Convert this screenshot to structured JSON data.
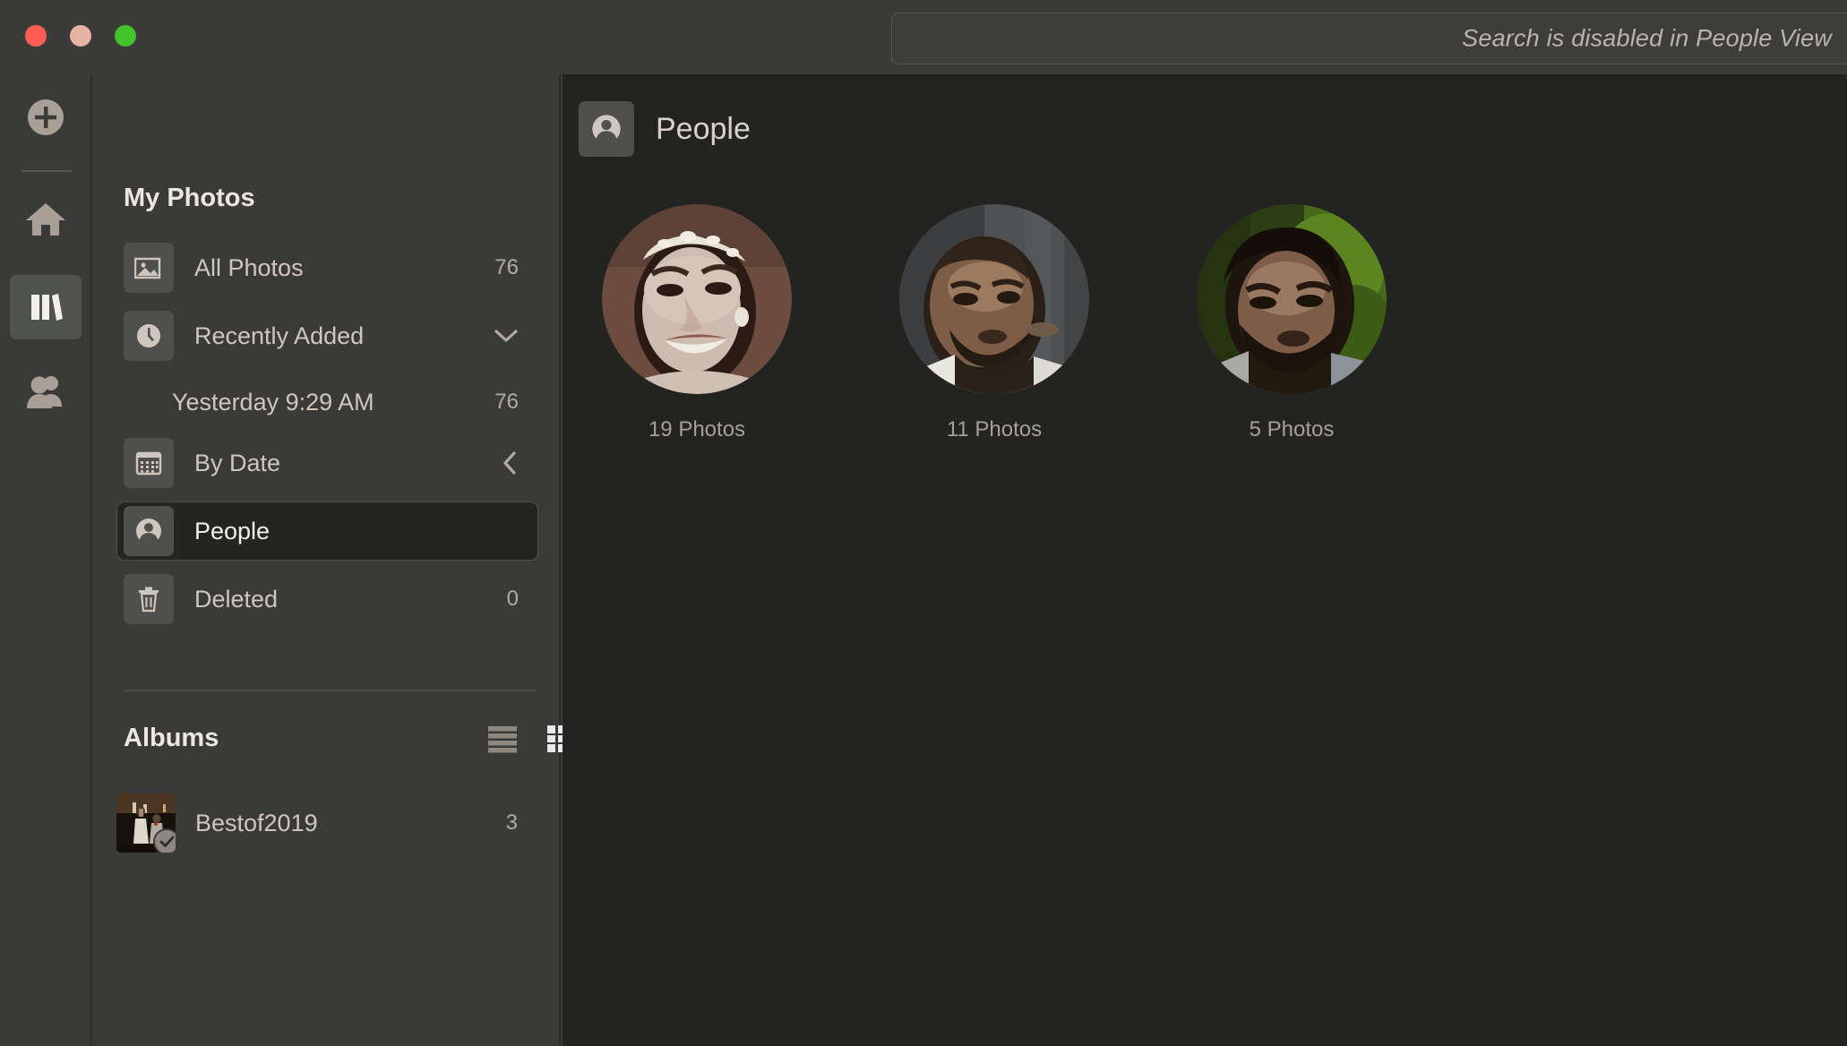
{
  "window": {
    "traffic_lights": [
      "close",
      "minimize",
      "zoom"
    ]
  },
  "search": {
    "placeholder": "Search is disabled in People View",
    "value": ""
  },
  "rail": {
    "items": [
      {
        "name": "add",
        "icon": "plus-circle-icon",
        "selected": false
      },
      {
        "name": "home",
        "icon": "home-icon",
        "selected": false
      },
      {
        "name": "library",
        "icon": "library-icon",
        "selected": true
      },
      {
        "name": "shared",
        "icon": "people-group-icon",
        "selected": false
      }
    ]
  },
  "sidebar": {
    "title": "My Photos",
    "nav": [
      {
        "label": "All Photos",
        "icon": "photo-icon",
        "count": "76",
        "selected": false,
        "accessory": "count"
      },
      {
        "label": "Recently Added",
        "icon": "clock-icon",
        "count": "",
        "selected": false,
        "accessory": "chevron-down"
      },
      {
        "label": "Yesterday 9:29 AM",
        "icon": "",
        "count": "76",
        "selected": false,
        "accessory": "count",
        "sub": true
      },
      {
        "label": "By Date",
        "icon": "calendar-icon",
        "count": "",
        "selected": false,
        "accessory": "chevron-left"
      },
      {
        "label": "People",
        "icon": "person-icon",
        "count": "",
        "selected": true,
        "accessory": "none"
      },
      {
        "label": "Deleted",
        "icon": "trash-icon",
        "count": "0",
        "selected": false,
        "accessory": "count"
      }
    ],
    "albums": {
      "title": "Albums",
      "tools": [
        {
          "name": "list-view-icon",
          "active": false
        },
        {
          "name": "detail-list-view-icon",
          "active": true
        },
        {
          "name": "add-album-icon",
          "active": false
        }
      ],
      "items": [
        {
          "label": "Bestof2019",
          "count": "3",
          "badge": "check"
        }
      ]
    }
  },
  "main": {
    "title": "People",
    "title_icon": "person-icon",
    "people": [
      {
        "count_label": "19 Photos",
        "face": "woman-tiara"
      },
      {
        "count_label": "11 Photos",
        "face": "man-beard-gray"
      },
      {
        "count_label": "5 Photos",
        "face": "man-beard-green"
      }
    ]
  },
  "colors": {
    "window_chrome": "#3a3b39",
    "sidebar_bg": "#3a3b39",
    "content_bg": "#232422",
    "selected_row_bg": "#242523",
    "icon_tile_bg": "#4f504e",
    "text_primary": "#ece7e2",
    "text_secondary": "#cfc6c0",
    "text_muted": "#a79f99",
    "traffic_red": "#fd5d52",
    "traffic_yellow": "#e8b3a7",
    "traffic_green": "#43c42b"
  }
}
